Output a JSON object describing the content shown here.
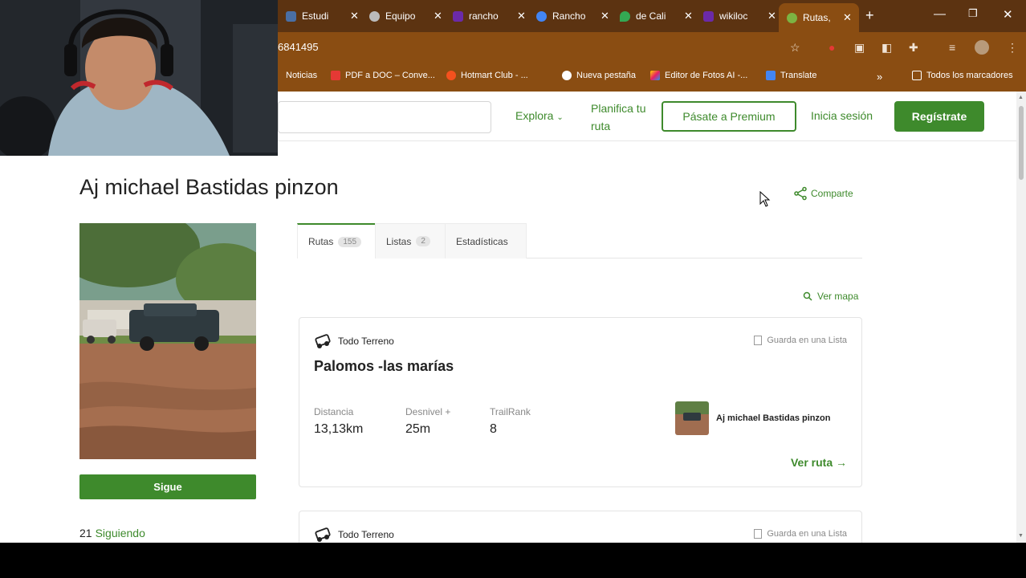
{
  "browser": {
    "tabs": [
      {
        "title": "Estudi",
        "color": "#4a6fa5"
      },
      {
        "title": "Equipo",
        "color": "#bbbbbb"
      },
      {
        "title": "rancho",
        "color": "#6b2aa8"
      },
      {
        "title": "Rancho",
        "color": "#4285f4"
      },
      {
        "title": "de Cali",
        "color": "#34a853"
      },
      {
        "title": "wikiloc",
        "color": "#6b2aa8"
      },
      {
        "title": "Rutas,",
        "color": "#7cb342",
        "active": true
      }
    ],
    "new_tab": "+",
    "url": "6841495",
    "bookmarks": [
      {
        "label": "Noticias"
      },
      {
        "label": "PDF a DOC – Conve..."
      },
      {
        "label": "Hotmart Club - ..."
      },
      {
        "label": "Nueva pestaña"
      },
      {
        "label": "Editor de Fotos AI -..."
      },
      {
        "label": "Translate"
      },
      {
        "label": "Todos los marcadores"
      }
    ],
    "more": "»"
  },
  "header": {
    "explora": "Explora",
    "planifica": "Planifica tu ruta",
    "premium": "Pásate a Premium",
    "login": "Inicia sesión",
    "register": "Regístrate"
  },
  "profile": {
    "name": "Aj michael Bastidas pinzon",
    "share": "Comparte",
    "follow": "Sigue",
    "following_count": "21",
    "following_label": "Siguiendo"
  },
  "tabs": [
    {
      "label": "Rutas",
      "count": "155",
      "active": true
    },
    {
      "label": "Listas",
      "count": "2"
    },
    {
      "label": "Estadísticas"
    }
  ],
  "ver_mapa": "Ver mapa",
  "routes": [
    {
      "activity": "Todo Terreno",
      "save": "Guarda en una Lista",
      "title": "Palomos -las marías",
      "stats": [
        {
          "label": "Distancia",
          "value": "13,13km"
        },
        {
          "label": "Desnivel +",
          "value": "25m"
        },
        {
          "label": "TrailRank",
          "value": "8"
        }
      ],
      "author": "Aj michael Bastidas pinzon",
      "cta": "Ver ruta →"
    },
    {
      "activity": "Todo Terreno",
      "save": "Guarda en una Lista"
    }
  ],
  "colors": {
    "accent": "#3e8a2c",
    "chrome": "#8a4d12",
    "tabbar": "#5c3311"
  }
}
